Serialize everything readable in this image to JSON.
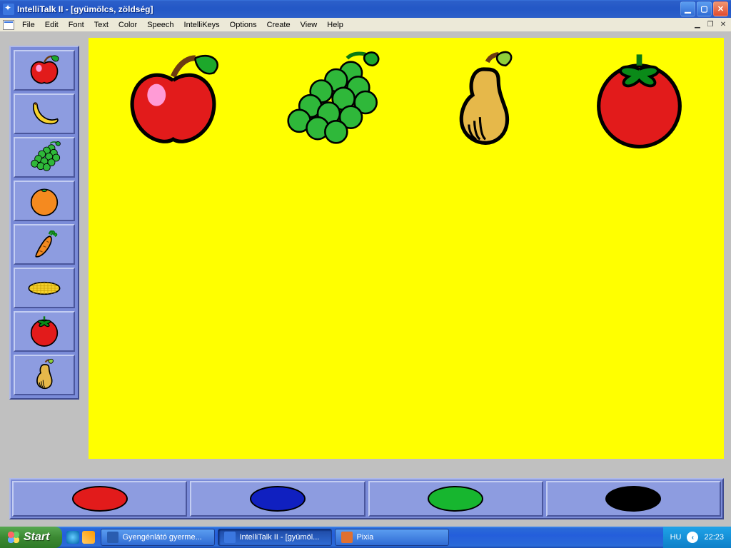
{
  "window": {
    "title": "IntelliTalk II - [gyümölcs, zöldség]"
  },
  "menu": {
    "items": [
      "File",
      "Edit",
      "Font",
      "Text",
      "Color",
      "Speech",
      "IntelliKeys",
      "Options",
      "Create",
      "View",
      "Help"
    ]
  },
  "sidebar": {
    "items": [
      {
        "name": "apple"
      },
      {
        "name": "banana"
      },
      {
        "name": "grapes"
      },
      {
        "name": "orange"
      },
      {
        "name": "carrot"
      },
      {
        "name": "corn"
      },
      {
        "name": "tomato"
      },
      {
        "name": "pear"
      }
    ]
  },
  "canvas": {
    "items": [
      {
        "name": "apple"
      },
      {
        "name": "grapes"
      },
      {
        "name": "pear"
      },
      {
        "name": "tomato"
      }
    ]
  },
  "colors": {
    "items": [
      {
        "name": "red",
        "hex": "#e21b1b"
      },
      {
        "name": "blue",
        "hex": "#1020c0"
      },
      {
        "name": "green",
        "hex": "#17b62f"
      },
      {
        "name": "black",
        "hex": "#000000"
      }
    ]
  },
  "taskbar": {
    "start": "Start",
    "tasks": [
      {
        "label": "Gyengénlátó gyerme...",
        "active": false,
        "icon": "word"
      },
      {
        "label": "IntelliTalk II - [gyümöl...",
        "active": true,
        "icon": "intellitalk"
      },
      {
        "label": "Pixia",
        "active": false,
        "icon": "pixia"
      }
    ],
    "lang": "HU",
    "clock": "22:23"
  }
}
